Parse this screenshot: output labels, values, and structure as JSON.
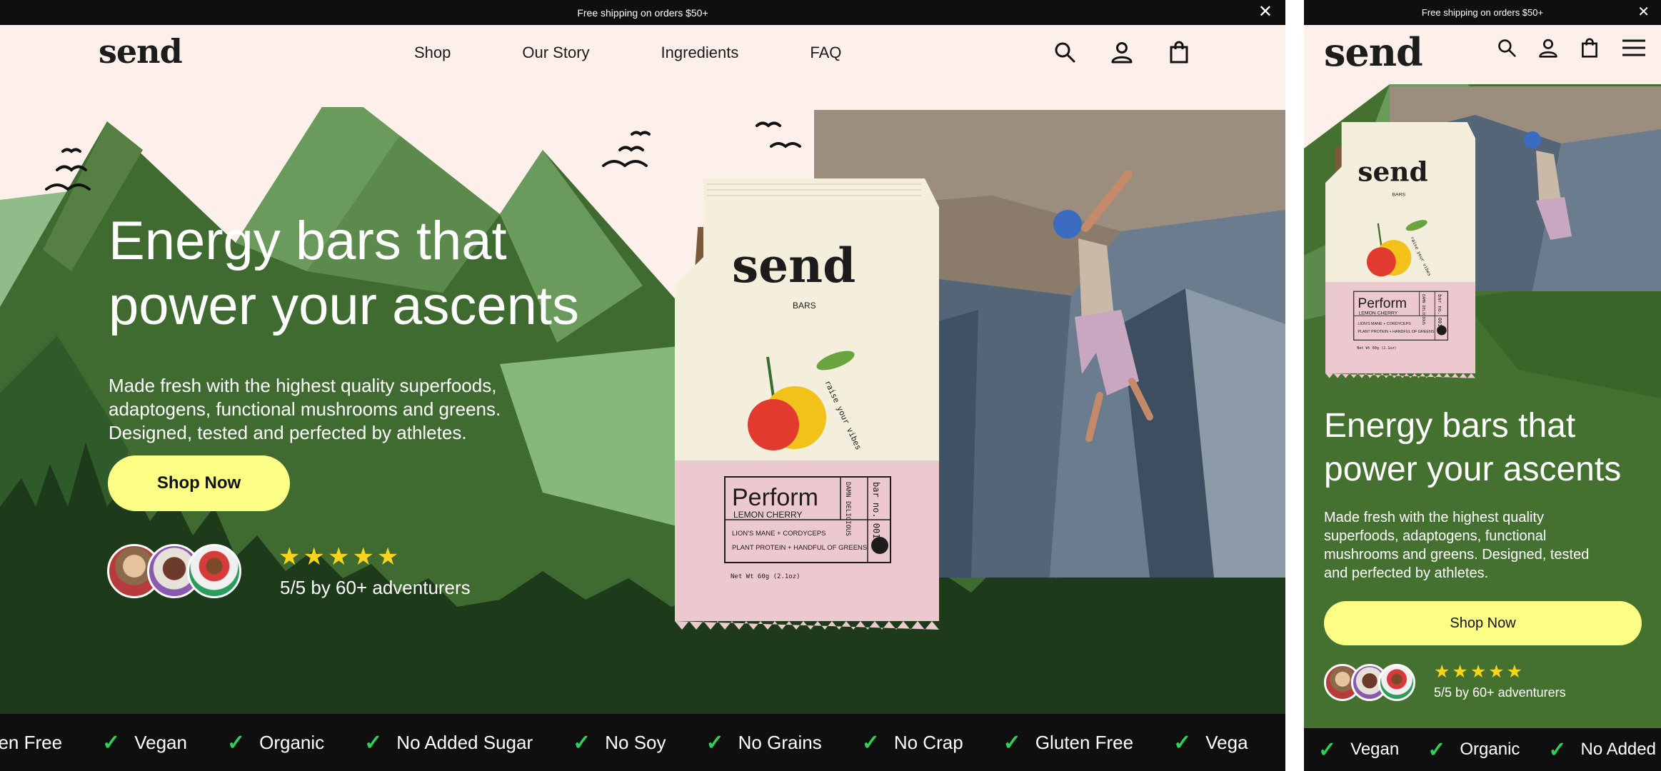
{
  "announcement": {
    "text": "Free shipping on orders $50+",
    "close": "✕"
  },
  "brand": {
    "logo": "send"
  },
  "nav": [
    "Shop",
    "Our Story",
    "Ingredients",
    "FAQ"
  ],
  "icons": {
    "search": "search-icon",
    "account": "user-icon",
    "cart": "bag-icon",
    "menu": "hamburger-icon"
  },
  "hero": {
    "title": "Energy bars that power your ascents",
    "subtitle": "Made fresh with the highest quality superfoods, adaptogens, functional mushrooms and greens. Designed, tested and perfected by athletes.",
    "cta": "Shop Now",
    "stars": "★★★★★",
    "rating_value": 5,
    "rating_text": "5/5 by 60+ adventurers"
  },
  "product": {
    "logo": "send",
    "bars": "BARS",
    "tagline": "raise your vibes",
    "name": "Perform",
    "flavor": "LEMON CHERRY",
    "side1": "DAMN DELICIOUS",
    "batch": "bar no. 001",
    "ingredients1": "LION'S MANE + CORDYCEPS",
    "ingredients2": "PLANT PROTEIN + HANDFUL OF GREENS",
    "weight": "Net Wt 60g (2.1oz)"
  },
  "ticker_desktop": [
    "luten Free",
    "Vegan",
    "Organic",
    "No Added Sugar",
    "No Soy",
    "No Grains",
    "No Crap",
    "Gluten Free",
    "Vega"
  ],
  "ticker_mobile": [
    "Vegan",
    "Organic",
    "No Added"
  ],
  "colors": {
    "cream": "#fdf0ea",
    "forest": "#44712f",
    "cta": "#fbfd85",
    "ticker_bg": "#0f0f0f",
    "check": "#2ed158",
    "star": "#f7d51d",
    "pack_pink": "#ecc9cf"
  }
}
